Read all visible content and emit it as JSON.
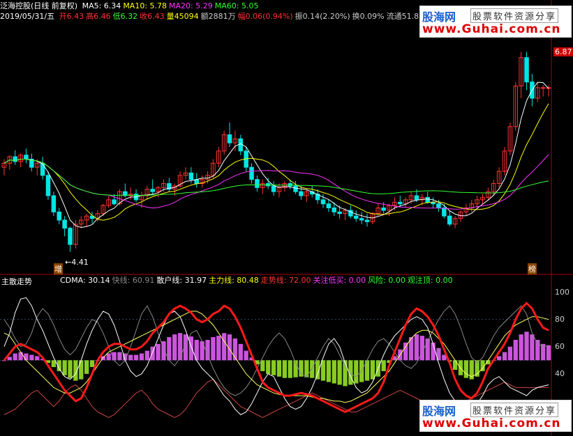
{
  "header": {
    "stock_name": "泛海控股(日线 前复权)",
    "date": "2019/05/31/五",
    "ma": [
      {
        "label": "MA5:",
        "value": "6.34",
        "color": "#ffffff"
      },
      {
        "label": "MA10:",
        "value": "5.78",
        "color": "#ffff00"
      },
      {
        "label": "MA20:",
        "value": "5.29",
        "color": "#ff33ff"
      },
      {
        "label": "MA60:",
        "value": "5.05",
        "color": "#33ff33"
      }
    ],
    "quote": [
      {
        "label": "开",
        "value": "6.43",
        "color": "#ff3333"
      },
      {
        "label": "高",
        "value": "6.46",
        "color": "#ff3333"
      },
      {
        "label": "低",
        "value": "6.32",
        "color": "#33ff33"
      },
      {
        "label": "收",
        "value": "6.43",
        "color": "#ff3333"
      },
      {
        "label": "量",
        "value": "45094",
        "color": "#ffff00"
      },
      {
        "label": "额",
        "value": "2881万",
        "color": "#cccccc"
      },
      {
        "label": "幅",
        "value": "0.06(0.94%)",
        "color": "#ff3333"
      },
      {
        "label": "振",
        "value": "0.14(2.20%)",
        "color": "#cccccc"
      },
      {
        "label": "换",
        "value": "0.09%",
        "color": "#cccccc"
      },
      {
        "label": "流通",
        "value": "51.8",
        "color": "#cccccc"
      }
    ]
  },
  "price_axis": {
    "top_label": "6.87",
    "low_label": "4.41",
    "low_marker": "←4.41"
  },
  "markers": {
    "zeng": "增",
    "bang": "榜"
  },
  "indicator": {
    "title": "主散走势",
    "items": [
      {
        "label": "CDMA:",
        "value": "30.14",
        "color": "#ffffff"
      },
      {
        "label": "快线:",
        "value": "60.91",
        "color": "#888888"
      },
      {
        "label": "散户线:",
        "value": "31.97",
        "color": "#ffffff"
      },
      {
        "label": "主力线:",
        "value": "80.48",
        "color": "#ffff00"
      },
      {
        "label": "走势线:",
        "value": "72.00",
        "color": "#ff3333"
      },
      {
        "label": "关注低买:",
        "value": "0.00",
        "color": "#ff33ff"
      },
      {
        "label": "风险:",
        "value": "0.00",
        "color": "#33ff33"
      },
      {
        "label": "观注顶:",
        "value": "0.00",
        "color": "#33ff33"
      }
    ],
    "axis_labels": [
      "100",
      "80",
      "60",
      "40"
    ]
  },
  "watermark": {
    "logo": "股海网",
    "slogan": "股票软件资源分享",
    "url": "www.Guhai.com.cn"
  },
  "colors": {
    "up": "#ff3333",
    "down": "#00e5e5",
    "ma5": "#ffffff",
    "ma10": "#ffff00",
    "ma20": "#ff33ff",
    "ma60": "#33ff33",
    "trend": "#ff1a1a",
    "bull_bar": "#cc55dd",
    "bear_bar": "#88cc22",
    "axis": "#aa0000"
  },
  "chart_data": [
    {
      "type": "candlestick",
      "title": "泛海控股(日线 前复权)",
      "ylim": [
        4.2,
        7.2
      ],
      "x_count": 100,
      "candles": [
        [
          5.45,
          5.55,
          5.35,
          5.5
        ],
        [
          5.5,
          5.6,
          5.42,
          5.58
        ],
        [
          5.58,
          5.66,
          5.48,
          5.52
        ],
        [
          5.52,
          5.62,
          5.45,
          5.6
        ],
        [
          5.6,
          5.68,
          5.5,
          5.55
        ],
        [
          5.55,
          5.62,
          5.4,
          5.45
        ],
        [
          5.45,
          5.55,
          5.35,
          5.5
        ],
        [
          5.5,
          5.58,
          5.3,
          5.35
        ],
        [
          5.35,
          5.4,
          5.05,
          5.1
        ],
        [
          5.1,
          5.15,
          4.85,
          4.9
        ],
        [
          4.9,
          4.95,
          4.75,
          4.8
        ],
        [
          4.8,
          4.85,
          4.6,
          4.7
        ],
        [
          4.7,
          4.72,
          4.41,
          4.5
        ],
        [
          4.5,
          4.8,
          4.45,
          4.75
        ],
        [
          4.75,
          4.85,
          4.7,
          4.8
        ],
        [
          4.8,
          4.88,
          4.72,
          4.85
        ],
        [
          4.85,
          4.9,
          4.76,
          4.82
        ],
        [
          4.82,
          4.92,
          4.78,
          4.88
        ],
        [
          4.88,
          5.0,
          4.85,
          4.98
        ],
        [
          4.98,
          5.1,
          4.95,
          5.05
        ],
        [
          5.05,
          5.12,
          4.98,
          5.0
        ],
        [
          5.0,
          5.18,
          4.98,
          5.15
        ],
        [
          5.15,
          5.25,
          5.08,
          5.1
        ],
        [
          5.1,
          5.2,
          5.05,
          5.12
        ],
        [
          5.12,
          5.18,
          5.02,
          5.05
        ],
        [
          5.05,
          5.15,
          4.95,
          5.1
        ],
        [
          5.1,
          5.22,
          5.05,
          5.18
        ],
        [
          5.18,
          5.3,
          5.12,
          5.15
        ],
        [
          5.15,
          5.22,
          5.08,
          5.2
        ],
        [
          5.2,
          5.3,
          5.15,
          5.25
        ],
        [
          5.25,
          5.32,
          5.15,
          5.18
        ],
        [
          5.18,
          5.25,
          5.1,
          5.22
        ],
        [
          5.22,
          5.4,
          5.2,
          5.35
        ],
        [
          5.35,
          5.45,
          5.3,
          5.38
        ],
        [
          5.38,
          5.45,
          5.25,
          5.3
        ],
        [
          5.3,
          5.38,
          5.2,
          5.25
        ],
        [
          5.25,
          5.35,
          5.2,
          5.3
        ],
        [
          5.3,
          5.4,
          5.25,
          5.35
        ],
        [
          5.35,
          5.55,
          5.32,
          5.5
        ],
        [
          5.5,
          5.7,
          5.45,
          5.65
        ],
        [
          5.65,
          5.9,
          5.6,
          5.85
        ],
        [
          5.85,
          6.0,
          5.7,
          5.75
        ],
        [
          5.75,
          5.9,
          5.65,
          5.8
        ],
        [
          5.8,
          5.85,
          5.6,
          5.65
        ],
        [
          5.65,
          5.7,
          5.4,
          5.45
        ],
        [
          5.45,
          5.5,
          5.25,
          5.3
        ],
        [
          5.3,
          5.35,
          5.15,
          5.2
        ],
        [
          5.2,
          5.3,
          5.12,
          5.25
        ],
        [
          5.25,
          5.32,
          5.18,
          5.22
        ],
        [
          5.22,
          5.28,
          5.1,
          5.15
        ],
        [
          5.15,
          5.25,
          5.08,
          5.2
        ],
        [
          5.2,
          5.28,
          5.15,
          5.25
        ],
        [
          5.25,
          5.3,
          5.18,
          5.22
        ],
        [
          5.22,
          5.28,
          5.12,
          5.15
        ],
        [
          5.15,
          5.22,
          5.05,
          5.1
        ],
        [
          5.1,
          5.18,
          5.02,
          5.15
        ],
        [
          5.15,
          5.22,
          5.08,
          5.12
        ],
        [
          5.12,
          5.18,
          5.0,
          5.05
        ],
        [
          5.05,
          5.12,
          4.95,
          5.0
        ],
        [
          5.0,
          5.05,
          4.9,
          4.95
        ],
        [
          4.95,
          5.02,
          4.85,
          4.9
        ],
        [
          4.9,
          4.98,
          4.82,
          4.88
        ],
        [
          4.88,
          4.95,
          4.8,
          4.92
        ],
        [
          4.92,
          4.98,
          4.82,
          4.85
        ],
        [
          4.85,
          4.92,
          4.78,
          4.82
        ],
        [
          4.82,
          4.9,
          4.75,
          4.8
        ],
        [
          4.8,
          4.88,
          4.72,
          4.78
        ],
        [
          4.78,
          4.9,
          4.75,
          4.88
        ],
        [
          4.88,
          5.0,
          4.85,
          4.95
        ],
        [
          4.95,
          5.02,
          4.88,
          4.92
        ],
        [
          4.92,
          5.0,
          4.85,
          4.98
        ],
        [
          4.98,
          5.08,
          4.92,
          5.02
        ],
        [
          5.02,
          5.1,
          4.96,
          5.0
        ],
        [
          5.0,
          5.08,
          4.95,
          5.05
        ],
        [
          5.05,
          5.15,
          5.0,
          5.1
        ],
        [
          5.1,
          5.18,
          5.02,
          5.05
        ],
        [
          5.05,
          5.12,
          4.98,
          5.08
        ],
        [
          5.08,
          5.15,
          5.0,
          5.02
        ],
        [
          5.02,
          5.08,
          4.95,
          5.0
        ],
        [
          5.0,
          5.05,
          4.9,
          4.95
        ],
        [
          4.95,
          5.0,
          4.82,
          4.85
        ],
        [
          4.85,
          4.92,
          4.72,
          4.75
        ],
        [
          4.75,
          4.85,
          4.7,
          4.82
        ],
        [
          4.82,
          4.92,
          4.78,
          4.9
        ],
        [
          4.9,
          5.0,
          4.85,
          4.95
        ],
        [
          4.95,
          5.05,
          4.9,
          5.0
        ],
        [
          5.0,
          5.1,
          4.95,
          5.05
        ],
        [
          5.05,
          5.12,
          5.0,
          5.08
        ],
        [
          5.08,
          5.2,
          5.05,
          5.15
        ],
        [
          5.15,
          5.3,
          5.1,
          5.25
        ],
        [
          5.25,
          5.45,
          5.2,
          5.4
        ],
        [
          5.4,
          5.7,
          5.35,
          5.65
        ],
        [
          5.65,
          6.0,
          5.6,
          5.95
        ],
        [
          5.95,
          6.5,
          5.9,
          6.45
        ],
        [
          6.45,
          6.87,
          6.3,
          6.8
        ],
        [
          6.8,
          6.87,
          6.4,
          6.5
        ],
        [
          6.5,
          6.6,
          6.2,
          6.3
        ],
        [
          6.3,
          6.5,
          6.25,
          6.43
        ],
        [
          6.43,
          6.46,
          6.32,
          6.43
        ],
        [
          6.43,
          6.46,
          6.32,
          6.43
        ]
      ]
    },
    {
      "type": "line",
      "title": "主散走势",
      "ylim": [
        0,
        110
      ],
      "x_count": 100,
      "series": [
        {
          "name": "走势线",
          "values": [
            50,
            55,
            60,
            62,
            60,
            58,
            56,
            52,
            46,
            40,
            34,
            28,
            24,
            20,
            22,
            30,
            40,
            50,
            56,
            60,
            62,
            62,
            60,
            58,
            58,
            60,
            64,
            70,
            74,
            78,
            84,
            88,
            90,
            88,
            85,
            80,
            78,
            80,
            84,
            86,
            90,
            88,
            82,
            74,
            64,
            54,
            44,
            34,
            30,
            28,
            26,
            24,
            24,
            25,
            26,
            25,
            24,
            22,
            20,
            18,
            16,
            14,
            12,
            14,
            16,
            18,
            20,
            22,
            26,
            34,
            46,
            56,
            66,
            76,
            84,
            88,
            86,
            82,
            76,
            68,
            58,
            48,
            36,
            28,
            24,
            22,
            26,
            34,
            44,
            50,
            56,
            62,
            70,
            80,
            88,
            92,
            88,
            80,
            74,
            72
          ]
        },
        {
          "name": "主力线",
          "values": [
            70,
            68,
            62,
            56,
            50,
            46,
            42,
            38,
            34,
            30,
            28,
            26,
            26,
            28,
            30,
            34,
            40,
            46,
            52,
            56,
            58,
            60,
            62,
            64,
            66,
            68,
            70,
            72,
            74,
            76,
            78,
            80,
            82,
            84,
            86,
            86,
            84,
            80,
            76,
            70,
            64,
            58,
            52,
            46,
            40,
            36,
            32,
            30,
            28,
            26,
            25,
            24,
            24,
            24,
            24,
            24,
            23,
            22,
            22,
            21,
            20,
            20,
            19,
            20,
            22,
            24,
            26,
            30,
            34,
            38,
            42,
            48,
            54,
            60,
            66,
            70,
            72,
            72,
            70,
            66,
            62,
            56,
            50,
            44,
            40,
            38,
            40,
            44,
            50,
            56,
            62,
            68,
            72,
            76,
            78,
            80,
            82,
            82,
            81,
            80
          ]
        },
        {
          "name": "散户线",
          "values": [
            60,
            70,
            85,
            95,
            96,
            90,
            80,
            72,
            62,
            52,
            44,
            38,
            36,
            40,
            50,
            62,
            72,
            80,
            86,
            84,
            76,
            64,
            50,
            42,
            38,
            40,
            46,
            56,
            66,
            76,
            84,
            86,
            82,
            72,
            60,
            50,
            44,
            40,
            36,
            30,
            24,
            20,
            14,
            10,
            12,
            18,
            26,
            34,
            40,
            38,
            30,
            22,
            16,
            14,
            16,
            22,
            30,
            40,
            52,
            62,
            66,
            60,
            48,
            38,
            30,
            26,
            28,
            34,
            44,
            54,
            62,
            68,
            72,
            76,
            80,
            82,
            80,
            74,
            62,
            48,
            36,
            26,
            20,
            14,
            12,
            14,
            18,
            24,
            32,
            36,
            38,
            34,
            30,
            28,
            26,
            24,
            28,
            30,
            31,
            32
          ]
        },
        {
          "name": "快线",
          "values": [
            80,
            74,
            66,
            60,
            62,
            70,
            82,
            88,
            84,
            76,
            66,
            58,
            54,
            58,
            66,
            74,
            80,
            78,
            70,
            60,
            50,
            46,
            50,
            60,
            72,
            84,
            90,
            82,
            70,
            58,
            50,
            46,
            52,
            62,
            70,
            72,
            64,
            54,
            44,
            36,
            30,
            26,
            24,
            26,
            30,
            36,
            44,
            52,
            60,
            66,
            70,
            66,
            58,
            48,
            40,
            38,
            44,
            52,
            60,
            66,
            62,
            54,
            46,
            40,
            38,
            42,
            50,
            58,
            64,
            66,
            62,
            56,
            50,
            46,
            44,
            48,
            56,
            64,
            72,
            80,
            86,
            90,
            84,
            74,
            62,
            52,
            48,
            52,
            60,
            68,
            74,
            78,
            82,
            86,
            90,
            84,
            70,
            62,
            60,
            61
          ]
        },
        {
          "name": "CDMA",
          "values": [
            10,
            12,
            14,
            18,
            22,
            26,
            28,
            24,
            20,
            16,
            20,
            26,
            30,
            32,
            28,
            22,
            16,
            12,
            10,
            8,
            10,
            14,
            18,
            22,
            26,
            28,
            24,
            18,
            14,
            12,
            10,
            8,
            10,
            14,
            20,
            26,
            30,
            34,
            36,
            32,
            28,
            24,
            20,
            16,
            14,
            12,
            10,
            8,
            10,
            12,
            14,
            16,
            18,
            20,
            22,
            24,
            26,
            24,
            22,
            20,
            18,
            16,
            14,
            12,
            12,
            14,
            16,
            18,
            20,
            22,
            24,
            26,
            28,
            26,
            24,
            22,
            20,
            18,
            16,
            14,
            12,
            14,
            16,
            18,
            20,
            22,
            24,
            26,
            28,
            30,
            32,
            34,
            32,
            30,
            30,
            30,
            30,
            30,
            30,
            30
          ]
        }
      ]
    }
  ]
}
